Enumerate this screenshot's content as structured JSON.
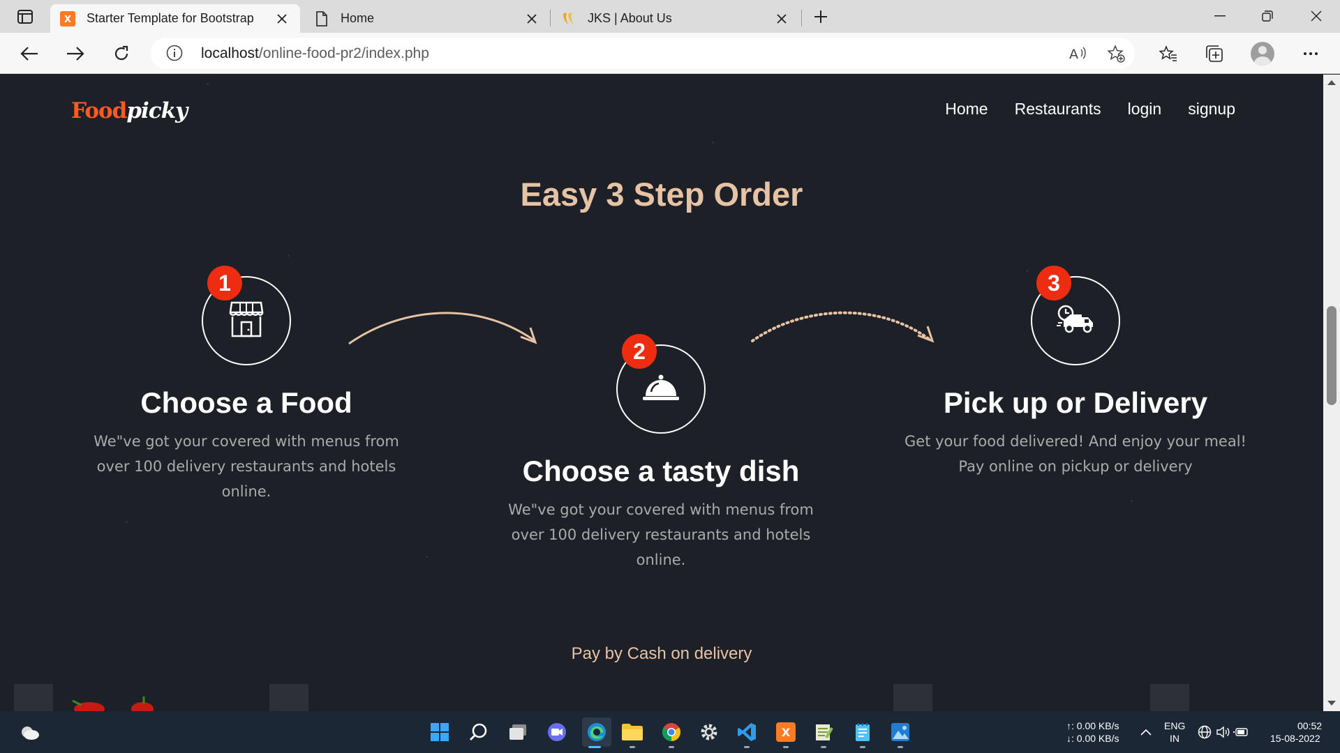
{
  "browser": {
    "tabs": [
      {
        "title": "Starter Template for Bootstrap",
        "favicon": "xampp-icon",
        "active": true
      },
      {
        "title": "Home",
        "favicon": "page-icon",
        "active": false
      },
      {
        "title": "JKS | About Us",
        "favicon": "jks-logo-icon",
        "active": false
      }
    ],
    "url_host": "localhost",
    "url_path": "/online-food-pr2/index.php"
  },
  "site": {
    "logo_part1": "Food",
    "logo_part2": "picky",
    "nav": [
      "Home",
      "Restaurants",
      "login",
      "signup"
    ],
    "section_title": "Easy 3 Step Order",
    "steps": [
      {
        "number": "1",
        "icon": "store-icon",
        "title": "Choose a Food",
        "description": "We\"ve got your covered with menus from over 100 delivery restaurants and hotels online."
      },
      {
        "number": "2",
        "icon": "food-cloche-icon",
        "title": "Choose a tasty dish",
        "description": "We\"ve got your covered with menus from over 100 delivery restaurants and hotels online."
      },
      {
        "number": "3",
        "icon": "delivery-truck-icon",
        "title": "Pick up or Delivery",
        "description": "Get your food delivered! And enjoy your meal! Pay online on pickup or delivery"
      }
    ],
    "payment_note": "Pay by Cash on delivery"
  },
  "taskbar": {
    "net_up": "↑: 0.00 KB/s",
    "net_down": "↓: 0.00 KB/s",
    "lang_1": "ENG",
    "lang_2": "IN",
    "time": "00:52",
    "date": "15-08-2022"
  },
  "colors": {
    "accent_orange": "#ff5a1f",
    "badge_red": "#ee2c12",
    "heading_peach": "#e7c3a6",
    "page_bg": "#1d2027"
  }
}
